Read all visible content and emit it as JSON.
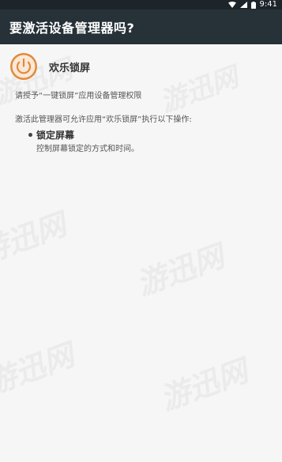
{
  "status_bar": {
    "time": "9:41",
    "icons": [
      "wifi-icon",
      "signal-icon",
      "battery-icon"
    ]
  },
  "dialog": {
    "title": "要激活设备管理器吗?"
  },
  "app": {
    "icon": "power-icon",
    "name": "欢乐锁屏",
    "accent_color": "#e08a3c"
  },
  "request_text": "请授予“一键锁屏”应用设备管理权限",
  "description_text": "激活此管理器可允许应用“欢乐锁屏”执行以下操作:",
  "policies": [
    {
      "title": "锁定屏幕",
      "description": "控制屏幕锁定的方式和时间。"
    }
  ],
  "watermark": {
    "text": "游迅网"
  },
  "colors": {
    "status_bar": "#1d252a",
    "app_bar": "#263238",
    "background": "#f6f6f6"
  }
}
